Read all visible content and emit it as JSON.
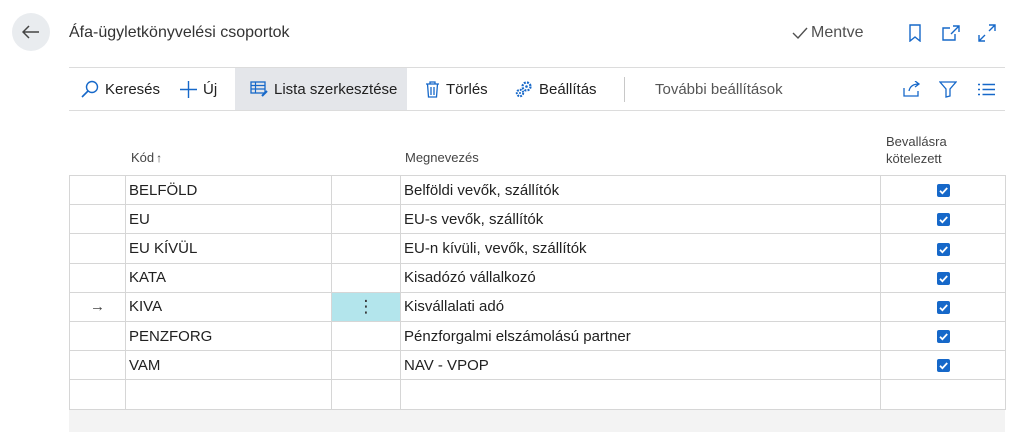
{
  "header": {
    "title": "Áfa-ügyletkönyvelési csoportok",
    "saved_label": "Mentve"
  },
  "actions": {
    "search": "Keresés",
    "new": "Új",
    "edit_list": "Lista szerkesztése",
    "delete": "Törlés",
    "settings": "Beállítás",
    "more": "További beállítások"
  },
  "columns": {
    "code": "Kód",
    "sort_indicator": "↑",
    "name": "Megnevezés",
    "required_line1": "Bevallásra",
    "required_line2": "kötelezett"
  },
  "rows": [
    {
      "code": "BELFÖLD",
      "name": "Belföldi vevők, szállítók",
      "required": true
    },
    {
      "code": "EU",
      "name": "EU-s vevők, szállítók",
      "required": true
    },
    {
      "code": "EU KÍVÜL",
      "name": "EU-n kívüli, vevők, szállítók",
      "required": true
    },
    {
      "code": "KATA",
      "name": "Kisadózó vállalkozó",
      "required": true
    },
    {
      "code": "KIVA",
      "name": "Kisvállalati adó",
      "required": true,
      "current": true
    },
    {
      "code": "PENZFORG",
      "name": "Pénzforgalmi elszámolású partner",
      "required": true
    },
    {
      "code": "VAM",
      "name": "NAV - VPOP",
      "required": true
    }
  ],
  "glyphs": {
    "current_row": "→",
    "row_menu": "⋮"
  },
  "colors": {
    "accent": "#1668c9",
    "selected_cell": "#b3e5ec",
    "active_action": "#e4e6ea"
  }
}
